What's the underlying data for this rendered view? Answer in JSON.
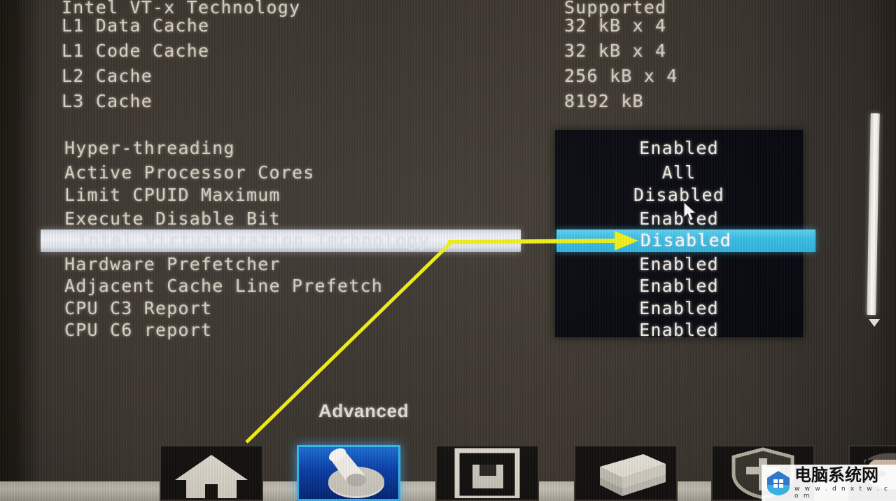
{
  "screen": {
    "menu_caption": "Advanced",
    "background_color": "#3a342e",
    "panel_color": "#05060d",
    "highlight_row_color": "#f0f2f6",
    "selected_value_color": "#39bfe8",
    "annotation_color": "#f2f216"
  },
  "info_block": {
    "rows": [
      {
        "label": "Intel VT-x Technology",
        "value": "Supported"
      },
      {
        "label": "L1 Data Cache",
        "value": "32 kB x 4"
      },
      {
        "label": "L1 Code Cache",
        "value": "32 kB x 4"
      },
      {
        "label": "L2 Cache",
        "value": "256 kB x 4"
      },
      {
        "label": "L3 Cache",
        "value": "8192 kB"
      }
    ]
  },
  "settings": {
    "rows": [
      {
        "label": "Hyper-threading",
        "value": "Enabled",
        "selected": false
      },
      {
        "label": "Active Processor Cores",
        "value": "All",
        "selected": false
      },
      {
        "label": "Limit CPUID Maximum",
        "value": "Disabled",
        "selected": false
      },
      {
        "label": "Execute Disable Bit",
        "value": "Enabled",
        "selected": false
      },
      {
        "label": "Intel Virtualization Technology",
        "value": "Disabled",
        "selected": true
      },
      {
        "label": "Hardware Prefetcher",
        "value": "Enabled",
        "selected": false
      },
      {
        "label": "Adjacent Cache Line Prefetch",
        "value": "Enabled",
        "selected": false
      },
      {
        "label": "CPU C3 Report",
        "value": "Enabled",
        "selected": false
      },
      {
        "label": "CPU C6 report",
        "value": "Enabled",
        "selected": false
      }
    ]
  },
  "scrollbar": {
    "down_arrow_icon": "chevron-down-icon"
  },
  "icon_bar": {
    "items": [
      {
        "name": "main-tab",
        "icon": "house-icon",
        "active": false
      },
      {
        "name": "advanced-tab",
        "icon": "switch-icon",
        "active": true
      },
      {
        "name": "save-tab",
        "icon": "floppy-disk-icon",
        "active": false
      },
      {
        "name": "boot-tab",
        "icon": "drive-stack-icon",
        "active": false
      },
      {
        "name": "security-tab",
        "icon": "shield-icon",
        "active": false
      },
      {
        "name": "exit-tab",
        "icon": "face-icon",
        "active": false
      }
    ]
  },
  "cursor": {
    "icon": "mouse-pointer-icon"
  },
  "annotation": {
    "arrow_icon": "arrow-right-icon",
    "pointer_line_icon": "diagonal-pointer-line"
  },
  "watermark": {
    "title": "电脑系统网",
    "url": "w w w . d n x t w . c o m",
    "logo_icon": "house-shield-logo"
  }
}
